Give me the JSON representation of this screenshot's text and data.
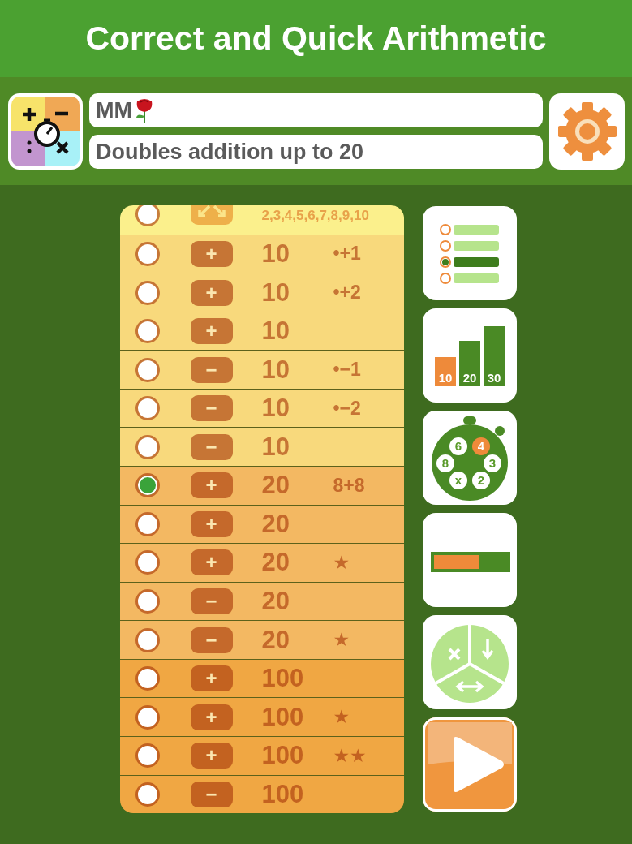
{
  "title": "Correct and Quick Arithmetic",
  "player": {
    "name": "MM",
    "description": "Doubles addition up to 20"
  },
  "groups": [
    {
      "color": "#fbf08c",
      "rows": [
        {
          "kind": "tables",
          "selected": false,
          "numbers": "2,3,4,5,6,7,8,9,10"
        }
      ]
    },
    {
      "color": "#f8d97c",
      "rows": [
        {
          "kind": "range",
          "selected": false,
          "op": "+",
          "range": "10",
          "note": "•+1"
        },
        {
          "kind": "range",
          "selected": false,
          "op": "+",
          "range": "10",
          "note": "•+2"
        },
        {
          "kind": "range",
          "selected": false,
          "op": "+",
          "range": "10"
        },
        {
          "kind": "range",
          "selected": false,
          "op": "−",
          "range": "10",
          "note": "•−1"
        },
        {
          "kind": "range",
          "selected": false,
          "op": "−",
          "range": "10",
          "note": "•−2"
        },
        {
          "kind": "range",
          "selected": false,
          "op": "−",
          "range": "10"
        }
      ]
    },
    {
      "color": "#f3b862",
      "rows": [
        {
          "kind": "range",
          "selected": true,
          "op": "+",
          "range": "20",
          "note": "8+8"
        },
        {
          "kind": "range",
          "selected": false,
          "op": "+",
          "range": "20"
        },
        {
          "kind": "range",
          "selected": false,
          "op": "+",
          "range": "20",
          "note": "★"
        },
        {
          "kind": "range",
          "selected": false,
          "op": "−",
          "range": "20"
        },
        {
          "kind": "range",
          "selected": false,
          "op": "−",
          "range": "20",
          "note": "★"
        }
      ]
    },
    {
      "color": "#f0a743",
      "rows": [
        {
          "kind": "range",
          "selected": false,
          "op": "+",
          "range": "100"
        },
        {
          "kind": "range",
          "selected": false,
          "op": "+",
          "range": "100",
          "note": "★"
        },
        {
          "kind": "range",
          "selected": false,
          "op": "+",
          "range": "100",
          "note": "★★"
        },
        {
          "kind": "range",
          "selected": false,
          "op": "−",
          "range": "100"
        }
      ]
    }
  ],
  "side_buttons": [
    {
      "kind": "list"
    },
    {
      "kind": "bars",
      "labels": [
        "10",
        "20",
        "30"
      ]
    },
    {
      "kind": "stopwatch",
      "labels": [
        "6",
        "4",
        "8",
        "3",
        "x",
        "2"
      ]
    },
    {
      "kind": "progress"
    },
    {
      "kind": "modes"
    },
    {
      "kind": "play"
    }
  ]
}
